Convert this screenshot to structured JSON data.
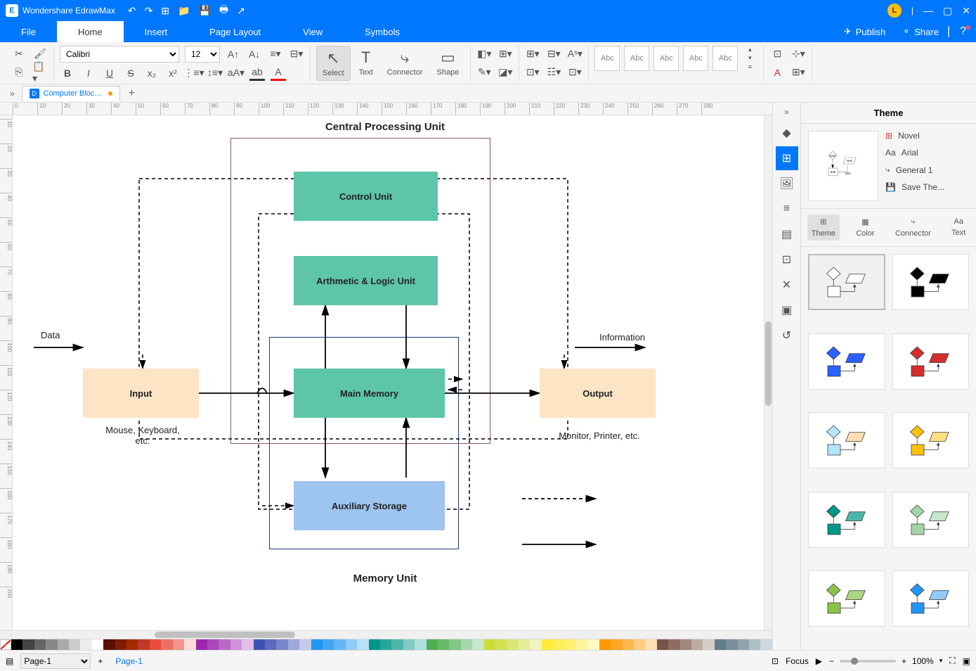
{
  "app": {
    "title": "Wondershare EdrawMax"
  },
  "titlebar_right": {
    "publish": "Publish",
    "share": "Share"
  },
  "menu": {
    "file": "File",
    "home": "Home",
    "insert": "Insert",
    "pagelayout": "Page Layout",
    "view": "View",
    "symbols": "Symbols"
  },
  "ribbon": {
    "font": "Calibri",
    "size": "12",
    "select": "Select",
    "text": "Text",
    "connector": "Connector",
    "shape": "Shape",
    "abc": "Abc"
  },
  "doctab": {
    "name": "Computer Block..."
  },
  "diagram": {
    "title_top": "Central Processing Unit",
    "title_bottom": "Memory Unit",
    "control": "Control Unit",
    "alu": "Arthmetic & Logic Unit",
    "main": "Main Memory",
    "aux": "Auxiliary Storage",
    "input": "Input",
    "output": "Output",
    "data": "Data",
    "info": "Information",
    "input_sub": "Mouse, Keyboard, etc.",
    "output_sub": "Monitor, Printer, etc."
  },
  "rpanel": {
    "title": "Theme",
    "novel": "Novel",
    "arial": "Arial",
    "general": "General 1",
    "save": "Save The...",
    "tab_theme": "Theme",
    "tab_color": "Color",
    "tab_connector": "Connector",
    "tab_text": "Text",
    "preview_text1": "text",
    "preview_text2": "text",
    "preview_text3": "text",
    "preview_text4": "text"
  },
  "pagebar": {
    "page_sel": "Page-1",
    "page_tab": "Page-1",
    "focus": "Focus",
    "zoom": "100%"
  }
}
